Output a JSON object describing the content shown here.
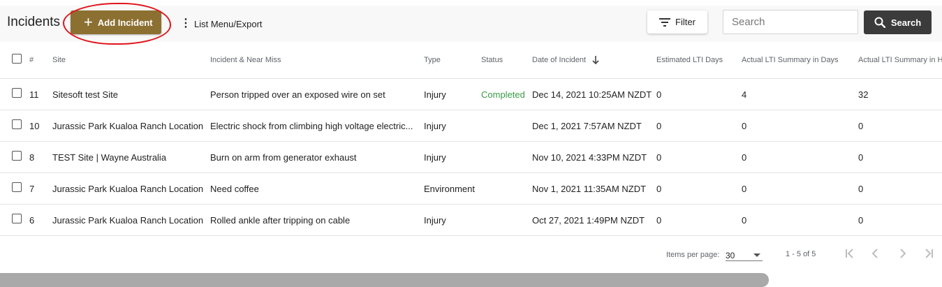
{
  "header": {
    "title": "Incidents",
    "add_label": "Add Incident",
    "menu_label": "List Menu/Export",
    "filter_label": "Filter",
    "search_placeholder": "Search",
    "search_label": "Search"
  },
  "table": {
    "columns": [
      "#",
      "Site",
      "Incident & Near Miss",
      "Type",
      "Status",
      "Date of Incident",
      "Estimated LTI Days",
      "Actual LTI Summary in Days",
      "Actual LTI Summary in H"
    ],
    "rows": [
      {
        "num": "11",
        "site": "Sitesoft test Site",
        "incident": "Person tripped over an exposed wire on set",
        "type": "Injury",
        "status": "Completed",
        "date": "Dec 14, 2021 10:25AM NZDT",
        "est": "0",
        "actual_days": "4",
        "actual_hours": "32"
      },
      {
        "num": "10",
        "site": "Jurassic Park Kualoa Ranch Location",
        "incident": "Electric shock from climbing high voltage electric...",
        "type": "Injury",
        "status": "",
        "date": "Dec 1, 2021 7:57AM NZDT",
        "est": "0",
        "actual_days": "0",
        "actual_hours": "0"
      },
      {
        "num": "8",
        "site": "TEST Site | Wayne Australia",
        "incident": "Burn on arm from generator exhaust",
        "type": "Injury",
        "status": "",
        "date": "Nov 10, 2021 4:33PM NZDT",
        "est": "0",
        "actual_days": "0",
        "actual_hours": "0"
      },
      {
        "num": "7",
        "site": "Jurassic Park Kualoa Ranch Location",
        "incident": "Need coffee",
        "type": "Environment",
        "status": "",
        "date": "Nov 1, 2021 11:35AM NZDT",
        "est": "0",
        "actual_days": "0",
        "actual_hours": "0"
      },
      {
        "num": "6",
        "site": "Jurassic Park Kualoa Ranch Location",
        "incident": "Rolled ankle after tripping on cable",
        "type": "Injury",
        "status": "",
        "date": "Oct 27, 2021 1:49PM NZDT",
        "est": "0",
        "actual_days": "0",
        "actual_hours": "0"
      }
    ]
  },
  "paginator": {
    "items_label": "Items per page:",
    "items_value": "30",
    "range": "1 - 5 of 5"
  },
  "colors": {
    "accent": "#8c7032",
    "completed": "#3a9b47",
    "search_button": "#3b3b3b",
    "annotation_circle": "#e0141b"
  },
  "icons": [
    "plus-icon",
    "more-vert-icon",
    "filter-icon",
    "search-icon",
    "sort-arrow-down-icon",
    "first-page-icon",
    "prev-page-icon",
    "next-page-icon",
    "last-page-icon"
  ]
}
